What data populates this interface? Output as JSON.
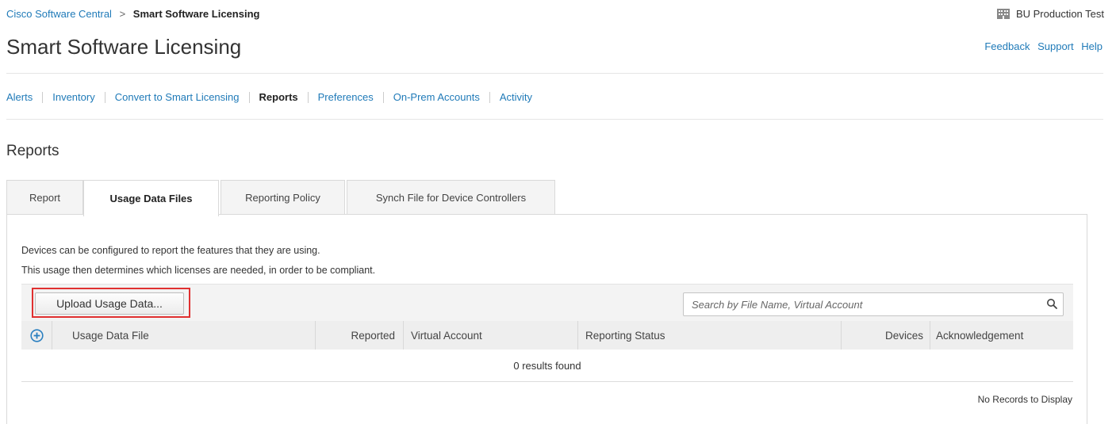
{
  "breadcrumb": {
    "root": "Cisco Software Central",
    "separator": ">",
    "current": "Smart Software Licensing"
  },
  "account": {
    "name": "BU Production Test",
    "icon": "building-icon"
  },
  "header": {
    "title": "Smart Software Licensing",
    "links": {
      "feedback": "Feedback",
      "support": "Support",
      "help": "Help"
    }
  },
  "nav": {
    "items": [
      {
        "label": "Alerts",
        "active": false
      },
      {
        "label": "Inventory",
        "active": false
      },
      {
        "label": "Convert to Smart Licensing",
        "active": false
      },
      {
        "label": "Reports",
        "active": true
      },
      {
        "label": "Preferences",
        "active": false
      },
      {
        "label": "On-Prem Accounts",
        "active": false
      },
      {
        "label": "Activity",
        "active": false
      }
    ]
  },
  "section": {
    "title": "Reports"
  },
  "tabs": [
    {
      "label": "Report",
      "active": false
    },
    {
      "label": "Usage Data Files",
      "active": true
    },
    {
      "label": "Reporting Policy",
      "active": false
    },
    {
      "label": "Synch File for Device Controllers",
      "active": false
    }
  ],
  "panel": {
    "description_1": "Devices can be configured to report the features that they are using.",
    "description_2": "This usage then determines which licenses are needed, in order to be compliant.",
    "upload_button": "Upload Usage Data...",
    "search_placeholder": "Search by File Name, Virtual Account",
    "table": {
      "columns": {
        "file": "Usage Data File",
        "reported": "Reported",
        "virtual_account": "Virtual Account",
        "status": "Reporting Status",
        "devices": "Devices",
        "ack": "Acknowledgement"
      },
      "results_text": "0 results found",
      "no_records": "No Records to Display"
    }
  },
  "colors": {
    "link": "#1f7ab8",
    "highlight": "#e03030",
    "expand_icon": "#2a7fc0"
  }
}
